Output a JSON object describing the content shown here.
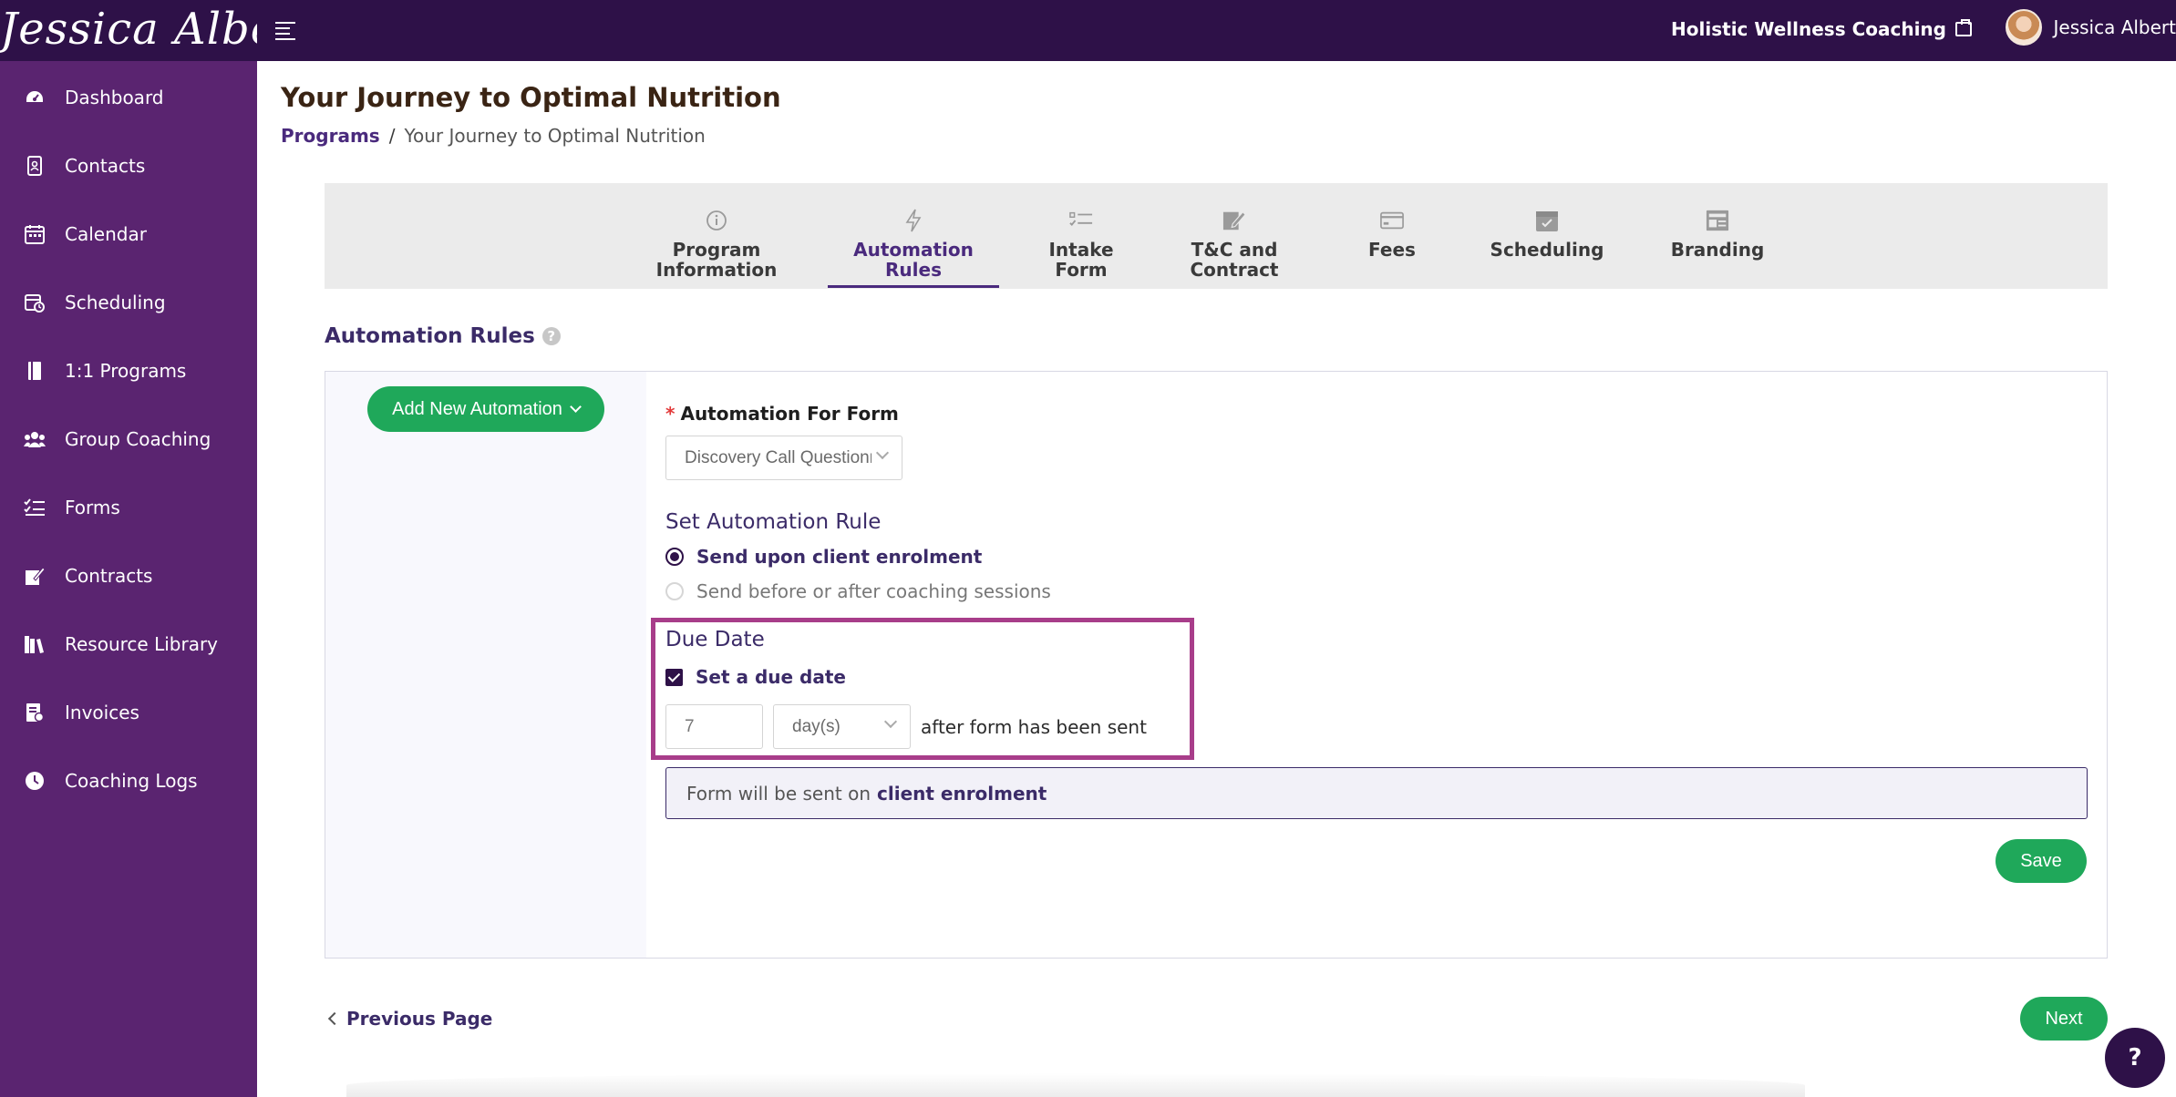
{
  "brand": {
    "logo_text": "Jessica Albert",
    "business_name": "Holistic Wellness Coaching",
    "user_name": "Jessica Albert"
  },
  "sidebar": {
    "items": [
      {
        "label": "Dashboard",
        "icon": "dashboard-icon"
      },
      {
        "label": "Contacts",
        "icon": "contacts-icon"
      },
      {
        "label": "Calendar",
        "icon": "calendar-icon"
      },
      {
        "label": "Scheduling",
        "icon": "scheduling-icon"
      },
      {
        "label": "1:1 Programs",
        "icon": "book-icon"
      },
      {
        "label": "Group Coaching",
        "icon": "group-icon"
      },
      {
        "label": "Forms",
        "icon": "forms-icon"
      },
      {
        "label": "Contracts",
        "icon": "contracts-icon"
      },
      {
        "label": "Resource Library",
        "icon": "library-icon"
      },
      {
        "label": "Invoices",
        "icon": "invoice-icon"
      },
      {
        "label": "Coaching Logs",
        "icon": "clock-icon"
      }
    ]
  },
  "page": {
    "title": "Your Journey to Optimal Nutrition",
    "breadcrumb": {
      "parent": "Programs",
      "separator": "/",
      "current": "Your Journey to Optimal Nutrition"
    }
  },
  "tabs": [
    {
      "line1": "Program",
      "line2": "Information",
      "icon": "info-icon",
      "active": false
    },
    {
      "line1": "Automation",
      "line2": "Rules",
      "icon": "bolt-icon",
      "active": true
    },
    {
      "line1": "Intake",
      "line2": "Form",
      "icon": "checklist-icon",
      "active": false
    },
    {
      "line1": "T&C and",
      "line2": "Contract",
      "icon": "contract-sign-icon",
      "active": false
    },
    {
      "line1": "Fees",
      "line2": "",
      "icon": "card-icon",
      "active": false
    },
    {
      "line1": "Scheduling",
      "line2": "",
      "icon": "calendar-check-icon",
      "active": false
    },
    {
      "line1": "Branding",
      "line2": "",
      "icon": "branding-icon",
      "active": false
    }
  ],
  "automation": {
    "section_title": "Automation Rules",
    "help_glyph": "?",
    "add_button": "Add New Automation",
    "form_label": "Automation For Form",
    "required_mark": "*",
    "form_select_value": "Discovery Call Questionnaire",
    "rule_title": "Set Automation Rule",
    "rule_options": [
      {
        "label": "Send upon client enrolment",
        "selected": true
      },
      {
        "label": "Send before or after coaching sessions",
        "selected": false
      }
    ],
    "due_date_title": "Due Date",
    "due_checkbox_label": "Set a due date",
    "due_checked": true,
    "due_value": "7",
    "due_unit": "day(s)",
    "after_text": "after form has been sent",
    "info_prefix": "Form will be sent on",
    "info_bold": "client enrolment",
    "save_label": "Save"
  },
  "footer": {
    "prev_label": "Previous Page",
    "next_label": "Next",
    "help_fab": "?"
  },
  "colors": {
    "topbar": "#2e1148",
    "sidebar": "#5a2470",
    "accent": "#4a2a7d",
    "button_green": "#1fa85a",
    "highlight": "#a83d8a"
  }
}
